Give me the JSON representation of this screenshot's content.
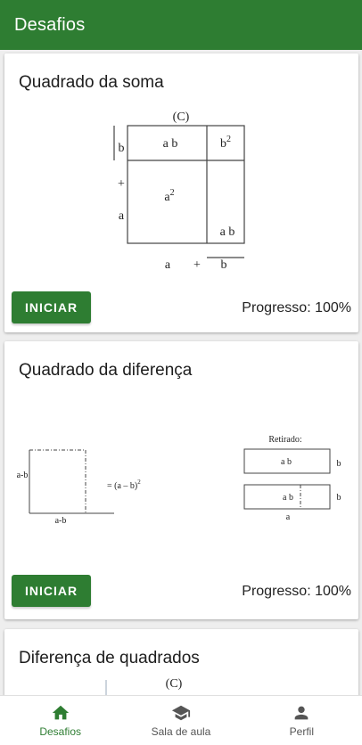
{
  "appbar": {
    "title": "Desafios"
  },
  "challenges": [
    {
      "title": "Quadrado da soma",
      "start_label": "INICIAR",
      "progress_text": "Progresso: 100%",
      "figure": {
        "caption": "(C)",
        "cell_ab_top": "a b",
        "cell_b2_base": "b",
        "cell_b2_exp": "2",
        "cell_a2_base": "a",
        "cell_a2_exp": "2",
        "cell_ab_right": "a b",
        "left_b": "b",
        "left_plus": "+",
        "left_a": "a",
        "bottom_a": "a",
        "bottom_plus": "+",
        "bottom_b": "b"
      }
    },
    {
      "title": "Quadrado da diferença",
      "start_label": "INICIAR",
      "progress_text": "Progresso: 100%",
      "figure": {
        "side_label": "a-b",
        "bottom_label": "a-b",
        "equation": "= (a – b)",
        "equation_exp": "2",
        "removed_label": "Retirado:",
        "rect1_label": "a b",
        "rect1_side": "b",
        "rect2_label": "a b",
        "rect2_side": "b",
        "rect2_bottom": "a"
      }
    },
    {
      "title": "Diferença de quadrados",
      "figure": {
        "caption": "(C)"
      }
    }
  ],
  "bottom_nav": {
    "items": [
      {
        "label": "Desafios",
        "icon": "home-icon",
        "active": true
      },
      {
        "label": "Sala de aula",
        "icon": "school-icon",
        "active": false
      },
      {
        "label": "Perfil",
        "icon": "person-icon",
        "active": false
      }
    ]
  },
  "colors": {
    "primary": "#2e7d32",
    "background": "#eeeeee",
    "card": "#ffffff"
  }
}
